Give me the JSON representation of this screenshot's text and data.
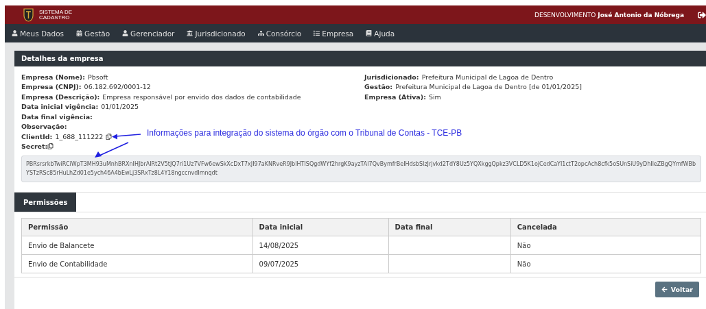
{
  "header": {
    "brand_lines": [
      "SISTEMA DE",
      "CADASTRO"
    ],
    "environment": "DESENVOLVIMENTO",
    "user": "José Antonio da Nóbrega"
  },
  "nav": [
    "Meus Dados",
    "Gestão",
    "Gerenciador",
    "Jurisdicionado",
    "Consórcio",
    "Empresa",
    "Ajuda"
  ],
  "details": {
    "title": "Detalhes da empresa",
    "left": [
      {
        "label": "Empresa (Nome):",
        "value": "Pbsoft"
      },
      {
        "label": "Empresa (CNPJ):",
        "value": "06.182.692/0001-12"
      },
      {
        "label": "Empresa (Descrição):",
        "value": "Empresa responsável por envido dos dados de contabilidade"
      },
      {
        "label": "Data inicial vigência:",
        "value": "01/01/2025"
      },
      {
        "label": "Data final vigência:"
      },
      {
        "label": "Observação:"
      }
    ],
    "right": [
      {
        "label": "Jurisdicionado:",
        "value": "Prefeitura Municipal de Lagoa de Dentro"
      },
      {
        "label": "Gestão:",
        "value": "Prefeitura Municipal de Lagoa de Dentro [de 01/01/2025]"
      },
      {
        "label": "Empresa (Ativa):",
        "value": "Sim"
      }
    ],
    "client_id": {
      "label": "ClientId:",
      "value": "1_688_111222"
    },
    "secret": {
      "label": "Secret:",
      "value": "PBRsrsrkbTwiRCiWpT3MH93uMnhBRXnIHJbrAIRt2V5tJQ7ri1Uz7VFw6ewSkXcDxT7xJI97aKNRveR9JbIHTISQgdWYf2hrgK9ayzTAI7QvBymfrBeIHdsbSIzJrjvkd2TdY8Uz5YQXkggQpkz3VCLD5K1ojCedCaYI1ctT2opcAch8cfk5oSUnSiU9yDhIleZBgQYmfWBbYSTzRSc85rHuLhZd01e5ych46A4bEwLj3SRxTz8L4Y18ngccnvdImnqdt"
    },
    "annotation": "Informações para integração do sistema do órgão com o Tribunal de Contas - TCE-PB"
  },
  "tabs": [
    {
      "label": "Permissões",
      "selected": true
    }
  ],
  "table": {
    "columns": [
      "Permissão",
      "Data inicial",
      "Data final",
      "Cancelada"
    ],
    "rows": [
      [
        "Envio de Balancete",
        "14/08/2025",
        "",
        "Não"
      ],
      [
        "Envio de Contabilidade",
        "09/07/2025",
        "",
        "Não"
      ]
    ]
  },
  "back_button": "Voltar"
}
